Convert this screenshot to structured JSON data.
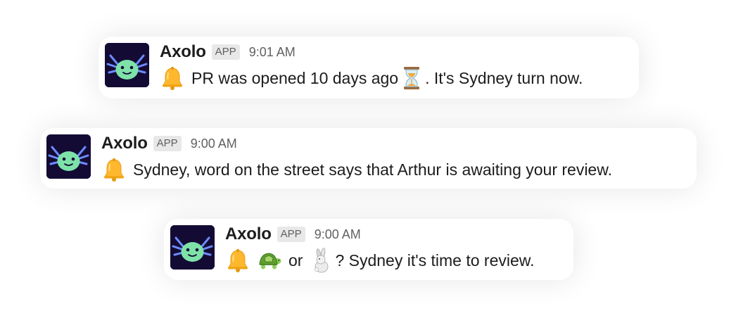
{
  "colors": {
    "avatar_bg": "#140b35",
    "axolotl_face": "#7ee2a8",
    "axolotl_gills": "#6b8cff",
    "app_badge_bg": "#e8e8e8",
    "text": "#1d1c1d",
    "muted_text": "#616061"
  },
  "messages": [
    {
      "sender": "Axolo",
      "badge": "APP",
      "time": "9:01 AM",
      "avatar_icon": "axolotl-avatar-icon",
      "parts": [
        {
          "type": "emoji",
          "icon": "bell-icon"
        },
        {
          "type": "text",
          "value": "PR was opened 10 days ago"
        },
        {
          "type": "emoji",
          "icon": "hourglass-icon"
        },
        {
          "type": "text",
          "value": ". It's Sydney turn now."
        }
      ]
    },
    {
      "sender": "Axolo",
      "badge": "APP",
      "time": "9:00 AM",
      "avatar_icon": "axolotl-avatar-icon",
      "parts": [
        {
          "type": "emoji",
          "icon": "bell-icon"
        },
        {
          "type": "text",
          "value": "Sydney, word on the street says that Arthur is awaiting your review."
        }
      ]
    },
    {
      "sender": "Axolo",
      "badge": "APP",
      "time": "9:00 AM",
      "avatar_icon": "axolotl-avatar-icon",
      "parts": [
        {
          "type": "emoji",
          "icon": "bell-icon"
        },
        {
          "type": "emoji",
          "icon": "turtle-icon"
        },
        {
          "type": "text",
          "value": "or"
        },
        {
          "type": "emoji",
          "icon": "rabbit-icon"
        },
        {
          "type": "text",
          "value": "? Sydney it's time to review."
        }
      ]
    }
  ]
}
